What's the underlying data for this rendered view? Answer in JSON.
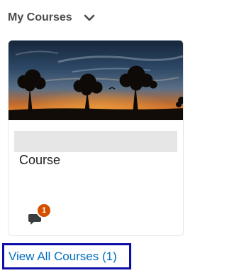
{
  "widget": {
    "title": "My Courses",
    "collapse_icon": "chevron-down-icon"
  },
  "course_card": {
    "name": "Course",
    "image": "sunset-trees-landscape",
    "notification_count": "1",
    "notification_icon": "chat-bubble-icon"
  },
  "footer": {
    "view_all_label": "View All Courses (1)"
  },
  "colors": {
    "title": "#494c4e",
    "link": "#006fbf",
    "badge": "#d44f00",
    "focus_border": "#0d0fa8"
  }
}
